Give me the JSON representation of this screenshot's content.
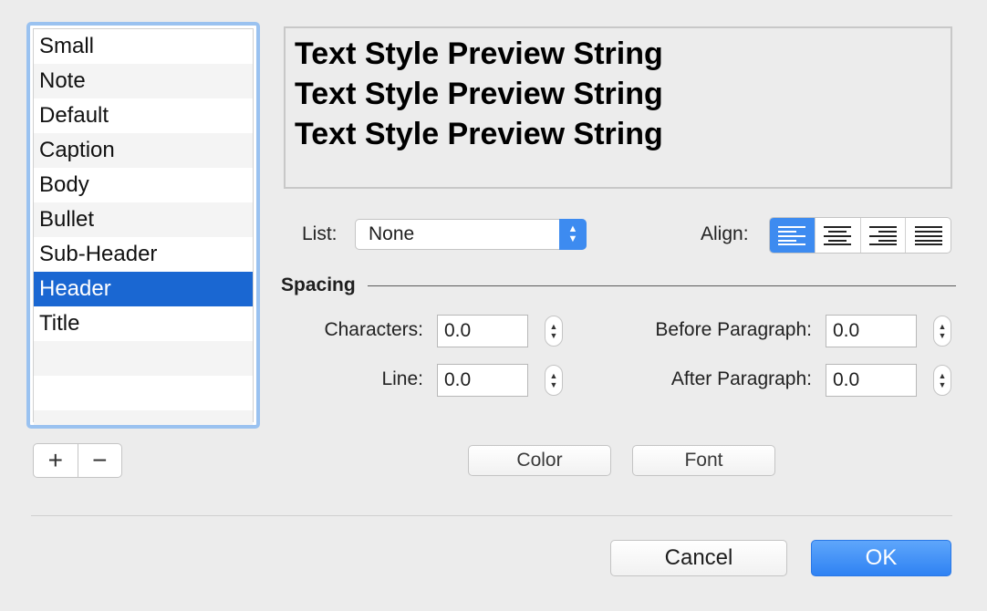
{
  "styles": {
    "items": [
      "Small",
      "Note",
      "Default",
      "Caption",
      "Body",
      "Bullet",
      "Sub-Header",
      "Header",
      "Title"
    ],
    "selected": "Header",
    "add_symbol": "+",
    "remove_symbol": "−"
  },
  "preview": {
    "lines": [
      "Text Style Preview String",
      "Text Style Preview String",
      "Text Style Preview String"
    ]
  },
  "list": {
    "label": "List:",
    "value": "None"
  },
  "align": {
    "label": "Align:",
    "options": [
      "align-left",
      "align-center",
      "align-right",
      "align-justify"
    ],
    "selected": "align-left"
  },
  "spacing": {
    "title": "Spacing",
    "characters_label": "Characters:",
    "characters_value": "0.0",
    "line_label": "Line:",
    "line_value": "0.0",
    "before_label": "Before Paragraph:",
    "before_value": "0.0",
    "after_label": "After Paragraph:",
    "after_value": "0.0"
  },
  "buttons": {
    "color": "Color",
    "font": "Font",
    "cancel": "Cancel",
    "ok": "OK"
  },
  "colors": {
    "accent": "#3d8bf0",
    "selection": "#1a67d2",
    "focus_ring": "#9ac2f0"
  }
}
